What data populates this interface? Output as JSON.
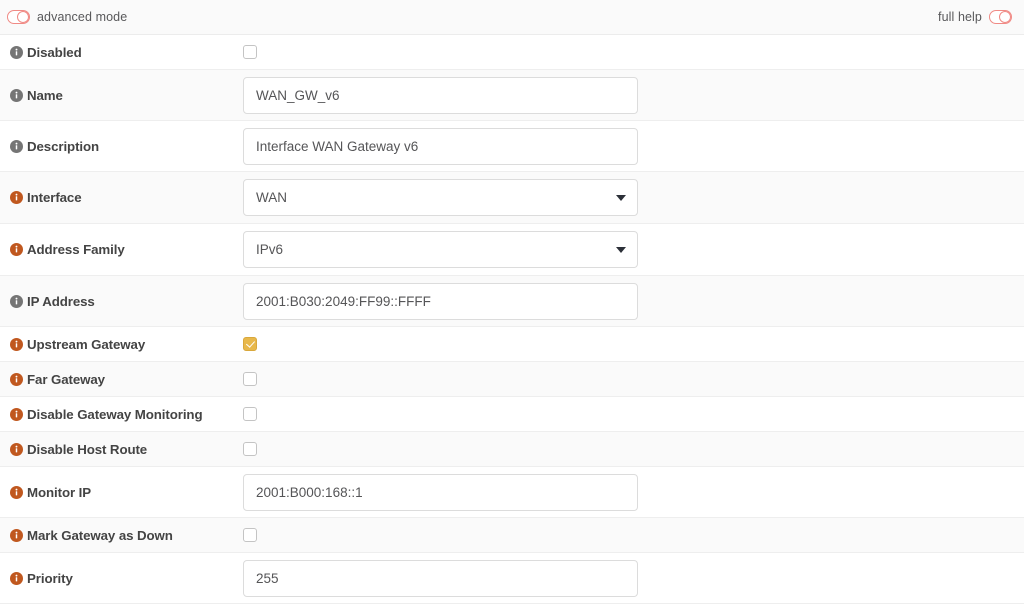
{
  "topbar": {
    "advanced_mode_label": "advanced mode",
    "advanced_mode_state": "off",
    "full_help_label": "full help",
    "full_help_state": "off"
  },
  "colors": {
    "info_icon_orange": "#c0581f",
    "info_icon_gray": "#757575",
    "checkbox_checked": "#e8b84b",
    "toggle_outline": "#f08a85",
    "label_text": "#444444",
    "row_alt_bg": "#fafafa"
  },
  "form": {
    "rows": [
      {
        "id": "disabled",
        "label": "Disabled",
        "icon": "info-icon",
        "icon_color": "gray",
        "control": "checkbox",
        "checked": false
      },
      {
        "id": "name",
        "label": "Name",
        "icon": "info-icon",
        "icon_color": "gray",
        "control": "text",
        "value": "WAN_GW_v6"
      },
      {
        "id": "description",
        "label": "Description",
        "icon": "info-icon",
        "icon_color": "gray",
        "control": "text",
        "value": "Interface WAN Gateway v6"
      },
      {
        "id": "interface",
        "label": "Interface",
        "icon": "info-icon",
        "icon_color": "orange",
        "control": "select",
        "value": "WAN"
      },
      {
        "id": "address-family",
        "label": "Address Family",
        "icon": "info-icon",
        "icon_color": "orange",
        "control": "select",
        "value": "IPv6"
      },
      {
        "id": "ip-address",
        "label": "IP Address",
        "icon": "info-icon",
        "icon_color": "gray",
        "control": "text",
        "value": "2001:B030:2049:FF99::FFFF"
      },
      {
        "id": "upstream-gateway",
        "label": "Upstream Gateway",
        "icon": "info-icon",
        "icon_color": "orange",
        "control": "checkbox",
        "checked": true
      },
      {
        "id": "far-gateway",
        "label": "Far Gateway",
        "icon": "info-icon",
        "icon_color": "orange",
        "control": "checkbox",
        "checked": false
      },
      {
        "id": "disable-gateway-monitoring",
        "label": "Disable Gateway Monitoring",
        "icon": "info-icon",
        "icon_color": "orange",
        "control": "checkbox",
        "checked": false
      },
      {
        "id": "disable-host-route",
        "label": "Disable Host Route",
        "icon": "info-icon",
        "icon_color": "orange",
        "control": "checkbox",
        "checked": false
      },
      {
        "id": "monitor-ip",
        "label": "Monitor IP",
        "icon": "info-icon",
        "icon_color": "orange",
        "control": "text",
        "value": "2001:B000:168::1"
      },
      {
        "id": "mark-gateway-as-down",
        "label": "Mark Gateway as Down",
        "icon": "info-icon",
        "icon_color": "orange",
        "control": "checkbox",
        "checked": false
      },
      {
        "id": "priority",
        "label": "Priority",
        "icon": "info-icon",
        "icon_color": "orange",
        "control": "text",
        "value": "255"
      }
    ]
  }
}
